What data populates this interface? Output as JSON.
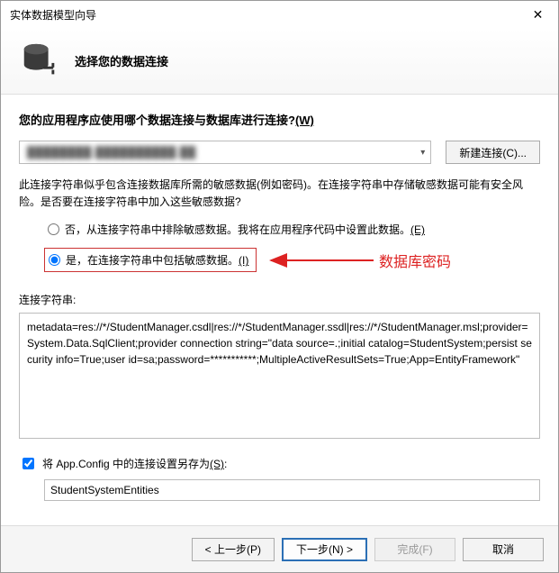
{
  "window": {
    "title": "实体数据模型向导"
  },
  "header": {
    "subtitle": "选择您的数据连接"
  },
  "question": {
    "text": "您的应用程序应使用哪个数据连接与数据库进行连接?",
    "accel": "(W)"
  },
  "connection": {
    "selected_display": "████████.██████████.██",
    "new_button": "新建连接(C)..."
  },
  "sensitive": {
    "explain": "此连接字符串似乎包含连接数据库所需的敏感数据(例如密码)。在连接字符串中存储敏感数据可能有安全风险。是否要在连接字符串中加入这些敏感数据?",
    "option_no": "否，从连接字符串中排除敏感数据。我将在应用程序代码中设置此数据。",
    "option_no_accel": "(E)",
    "option_yes": "是，在连接字符串中包括敏感数据。",
    "option_yes_accel": "(I)",
    "annotation": "数据库密码"
  },
  "connstr": {
    "label": "连接字符串:",
    "value": "metadata=res://*/StudentManager.csdl|res://*/StudentManager.ssdl|res://*/StudentManager.msl;provider=System.Data.SqlClient;provider connection string=\"data source=.;initial catalog=StudentSystem;persist security info=True;user id=sa;password=***********;MultipleActiveResultSets=True;App=EntityFramework\""
  },
  "save": {
    "check_label": "将 App.Config 中的连接设置另存为",
    "check_accel": "(S)",
    "value": "StudentSystemEntities"
  },
  "footer": {
    "prev": "< 上一步(P)",
    "next": "下一步(N) >",
    "finish": "完成(F)",
    "cancel": "取消"
  }
}
